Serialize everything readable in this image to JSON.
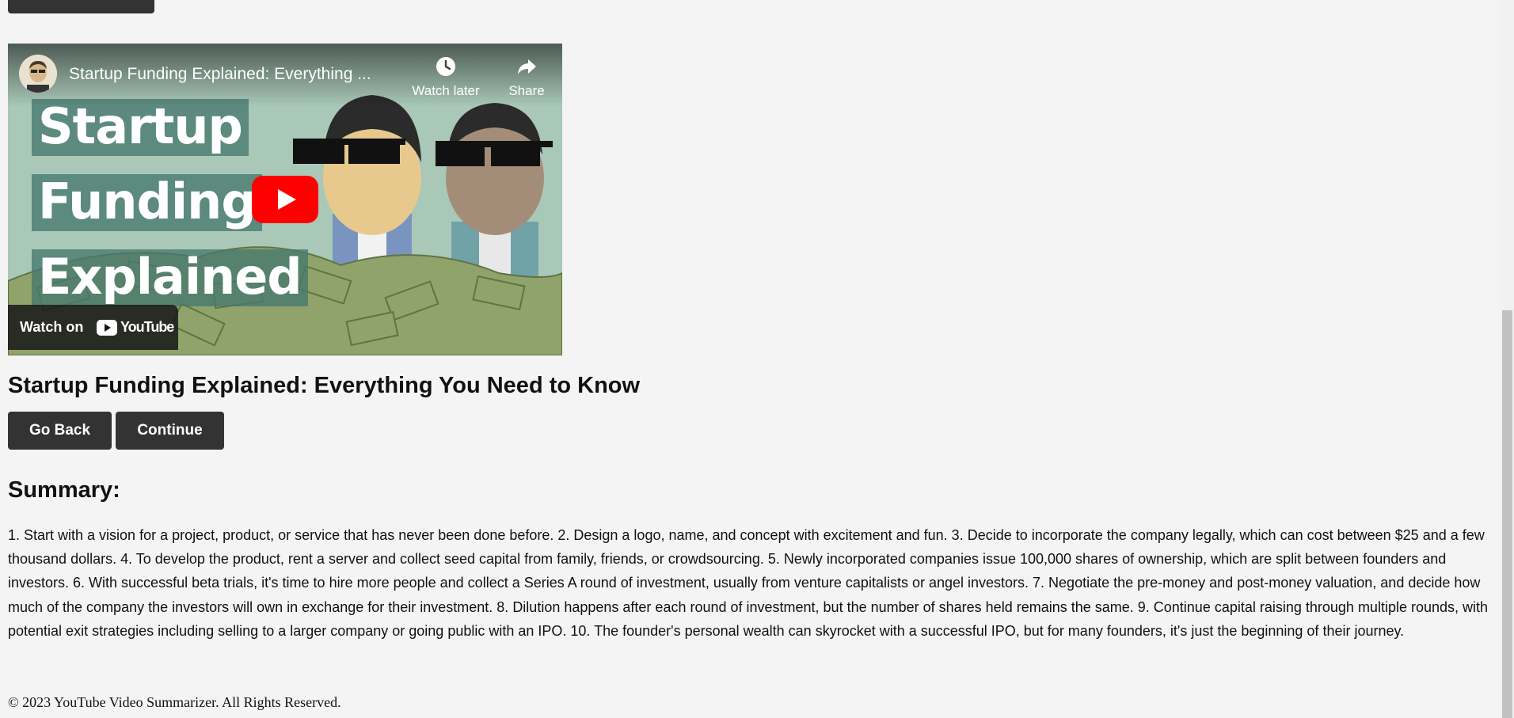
{
  "video": {
    "title": "Startup Funding Explained: Everything ...",
    "watch_later_label": "Watch later",
    "share_label": "Share",
    "thumbnail_lines": [
      "Startup",
      "Funding",
      "Explained"
    ],
    "watch_on_label": "Watch on",
    "youtube_wordmark": "YouTube"
  },
  "main": {
    "title": "Startup Funding Explained: Everything You Need to Know",
    "go_back_label": "Go Back",
    "continue_label": "Continue",
    "summary_heading": "Summary:",
    "summary_text": "1. Start with a vision for a project, product, or service that has never been done before. 2. Design a logo, name, and concept with excitement and fun. 3. Decide to incorporate the company legally, which can cost between $25 and a few thousand dollars. 4. To develop the product, rent a server and collect seed capital from family, friends, or crowdsourcing. 5. Newly incorporated companies issue 100,000 shares of ownership, which are split between founders and investors. 6. With successful beta trials, it's time to hire more people and collect a Series A round of investment, usually from venture capitalists or angel investors. 7. Negotiate the pre-money and post-money valuation, and decide how much of the company the investors will own in exchange for their investment. 8. Dilution happens after each round of investment, but the number of shares held remains the same. 9. Continue capital raising through multiple rounds, with potential exit strategies including selling to a larger company or going public with an IPO. 10. The founder's personal wealth can skyrocket with a successful IPO, but for many founders, it's just the beginning of their journey."
  },
  "footer": {
    "text": "© 2023 YouTube Video Summarizer. All Rights Reserved."
  },
  "colors": {
    "page_background": "#f4f4f4",
    "button_background": "#333333",
    "button_text": "#ffffff",
    "youtube_red": "#ff0000"
  },
  "icons": {
    "watch_later": "clock-icon",
    "share": "share-arrow-icon",
    "play": "youtube-play-icon"
  }
}
